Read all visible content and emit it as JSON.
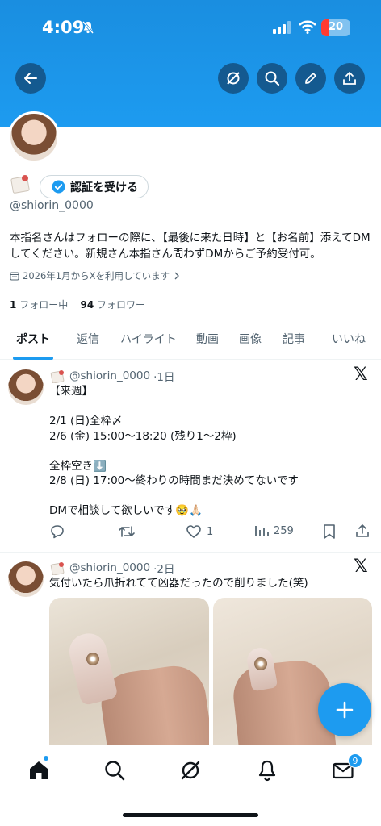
{
  "status": {
    "time": "4:09",
    "battery": "20"
  },
  "header": {
    "back_icon": "arrow-left-icon",
    "grok_icon": "grok-icon",
    "search_icon": "search-icon",
    "edit_icon": "pencil-icon",
    "share_icon": "share-icon"
  },
  "profile": {
    "verify_label": "認証を受ける",
    "handle": "@shiorin_0000",
    "bio_line1": "本指名さんはフォローの際に､【最後に来た日時】と【お名前】添えてDM",
    "bio_line2": "してください。新規さん本指さん問わずDMからご予約受付可。",
    "joined": "2026年1月からXを利用しています",
    "following_count": "1",
    "following_label": "フォロー中",
    "followers_count": "94",
    "followers_label": "フォロワー"
  },
  "tabs": [
    {
      "label": "ポスト",
      "active": true
    },
    {
      "label": "返信"
    },
    {
      "label": "ハイライト"
    },
    {
      "label": "動画"
    },
    {
      "label": "画像"
    },
    {
      "label": "記事"
    },
    {
      "label": "いいね"
    }
  ],
  "posts": [
    {
      "handle": "@shiorin_0000",
      "time": "·1日",
      "text": "【来週】\n\n2/1 (日)全枠〆\n2/6 (金) 15:00〜18:20 (残り1〜2枠)\n\n全枠空き⬇️\n2/8 (日) 17:00〜終わりの時間まだ決めてないです\n\nDMで相談して欲しいです🥹🙏🏻",
      "likes": "1",
      "views": "259"
    },
    {
      "handle": "@shiorin_0000",
      "time": "·2日",
      "text": "気付いたら爪折れてて凶器だったので削りました(笑)"
    }
  ],
  "nav": {
    "home": "home-icon",
    "search": "search-icon",
    "grok": "grok-icon",
    "notifications": "bell-icon",
    "messages": "mail-icon",
    "messages_badge": "9"
  },
  "colors": {
    "accent": "#1d9bf0",
    "text": "#0f1419",
    "muted": "#536471"
  }
}
